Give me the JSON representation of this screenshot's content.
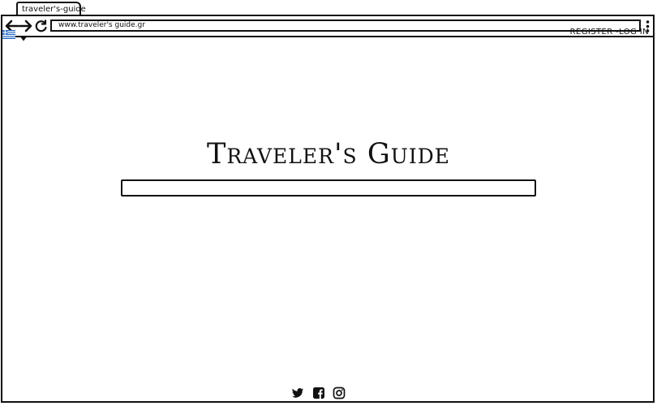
{
  "browser": {
    "tab_title": "traveler's-guide",
    "url": "www.traveler's guide.gr"
  },
  "header": {
    "language_flag": "greece-flag-icon",
    "auth_link": "REGISTER -LOG IN"
  },
  "main": {
    "site_title": "Traveler's Guide",
    "search": {
      "value": "",
      "placeholder": ""
    }
  },
  "footer": {
    "social_icons": [
      "twitter-icon",
      "facebook-icon",
      "instagram-icon"
    ]
  },
  "colors": {
    "ink": "#111111",
    "flag_blue": "#2b6cc4",
    "background": "#ffffff"
  }
}
